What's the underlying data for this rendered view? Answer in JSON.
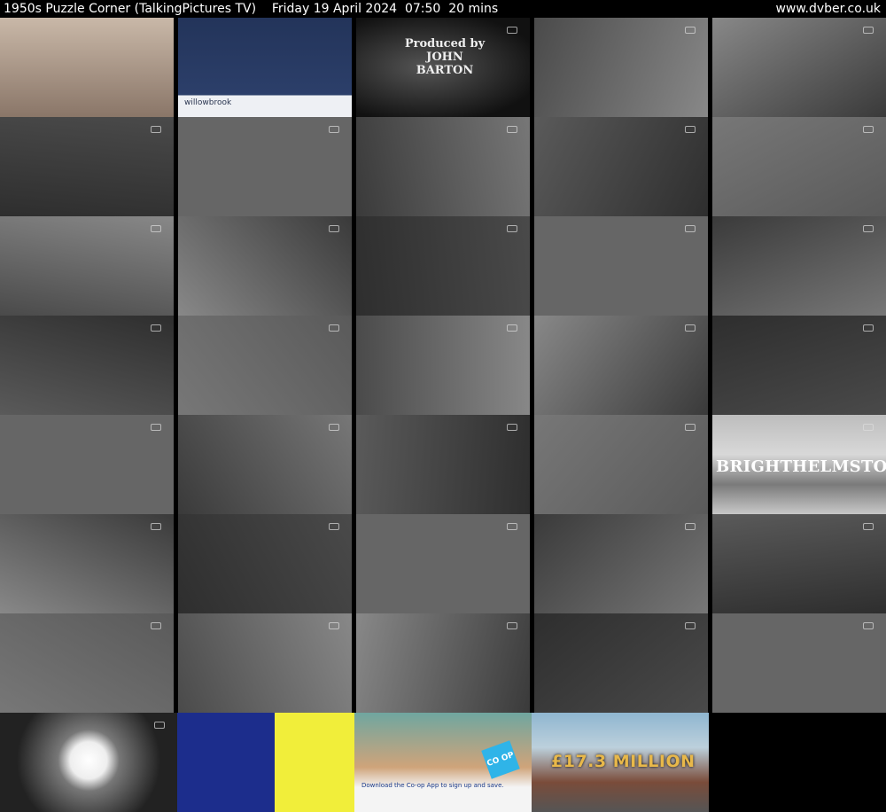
{
  "header": {
    "title": "1950s Puzzle Corner (TalkingPictures TV)    Friday 19 April 2024  07:50  20 mins",
    "site": "www.dvber.co.uk"
  },
  "captions": {
    "producer": "Produced by\nJOHN\nBARTON",
    "willowbrook": "willowbrook",
    "town": "BRIGHTHELMSTON",
    "coop_text": "Download the Co-op App to sign up and save.",
    "coop_logo": "CO OP",
    "lottery": "£17.3 MILLION"
  },
  "thumbnails": [
    {
      "id": "t1",
      "tone": "sepia"
    },
    {
      "id": "t2",
      "tone": "ad-willowbrook"
    },
    {
      "id": "t3",
      "tone": "credit"
    },
    {
      "id": "t4",
      "tone": "bw"
    },
    {
      "id": "t5",
      "tone": "bw"
    },
    {
      "id": "t6",
      "tone": "bw"
    },
    {
      "id": "t7",
      "tone": "bw"
    },
    {
      "id": "t8",
      "tone": "bw"
    },
    {
      "id": "t9",
      "tone": "bw"
    },
    {
      "id": "t10",
      "tone": "bw"
    },
    {
      "id": "t11",
      "tone": "bw"
    },
    {
      "id": "t12",
      "tone": "bw"
    },
    {
      "id": "t13",
      "tone": "bw"
    },
    {
      "id": "t14",
      "tone": "bw"
    },
    {
      "id": "t15",
      "tone": "bw"
    },
    {
      "id": "t16",
      "tone": "bw"
    },
    {
      "id": "t17",
      "tone": "bw"
    },
    {
      "id": "t18",
      "tone": "bw"
    },
    {
      "id": "t19",
      "tone": "bw"
    },
    {
      "id": "t20",
      "tone": "bw"
    },
    {
      "id": "t21",
      "tone": "bw"
    },
    {
      "id": "t22",
      "tone": "bw"
    },
    {
      "id": "t23",
      "tone": "bw"
    },
    {
      "id": "t24",
      "tone": "bw"
    },
    {
      "id": "t25",
      "tone": "town"
    },
    {
      "id": "t26",
      "tone": "bw"
    },
    {
      "id": "t27",
      "tone": "bw"
    },
    {
      "id": "t28",
      "tone": "bw"
    },
    {
      "id": "t29",
      "tone": "bw"
    },
    {
      "id": "t30",
      "tone": "bw"
    },
    {
      "id": "t31",
      "tone": "bw"
    },
    {
      "id": "t32",
      "tone": "bw"
    },
    {
      "id": "t33",
      "tone": "bw"
    },
    {
      "id": "t34",
      "tone": "bw"
    },
    {
      "id": "t35",
      "tone": "bw"
    },
    {
      "id": "t36",
      "tone": "bw-screen"
    },
    {
      "id": "t37",
      "tone": "ad-yellow"
    },
    {
      "id": "t38",
      "tone": "ad-coop"
    },
    {
      "id": "t39",
      "tone": "ad-lottery"
    }
  ]
}
